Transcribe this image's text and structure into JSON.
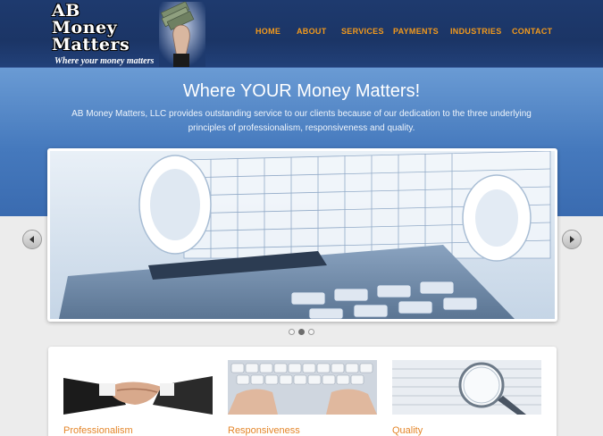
{
  "logo": {
    "line1": "AB",
    "line2": "Money",
    "line3": "Matters",
    "tagline": "Where your money matters",
    "image_icon": "money-in-hand"
  },
  "nav": {
    "items": [
      {
        "label": "HOME"
      },
      {
        "label": "ABOUT"
      },
      {
        "label": "SERVICES"
      },
      {
        "label": "PAYMENTS"
      },
      {
        "label": "INDUSTRIES"
      },
      {
        "label": "CONTACT"
      }
    ],
    "color": "#f39a1c"
  },
  "hero": {
    "title": "Where YOUR Money Matters!",
    "text": "AB Money Matters, LLC provides outstanding service to our clients because of our dedication to the three underlying principles of professionalism, responsiveness and quality."
  },
  "slider": {
    "image": "calculator-and-spreadsheet-rolls",
    "prev_icon": "chevron-left-icon",
    "next_icon": "chevron-right-icon",
    "dots": 3,
    "active_dot": 2
  },
  "features": [
    {
      "title": "Professionalism",
      "image": "handshake"
    },
    {
      "title": "Responsiveness",
      "image": "hands-on-keyboard"
    },
    {
      "title": "Quality",
      "image": "magnifier-on-document"
    }
  ],
  "colors": {
    "header_bg": "#1e3a6e",
    "hero_bg": "#4579bd",
    "accent": "#e4862a"
  }
}
